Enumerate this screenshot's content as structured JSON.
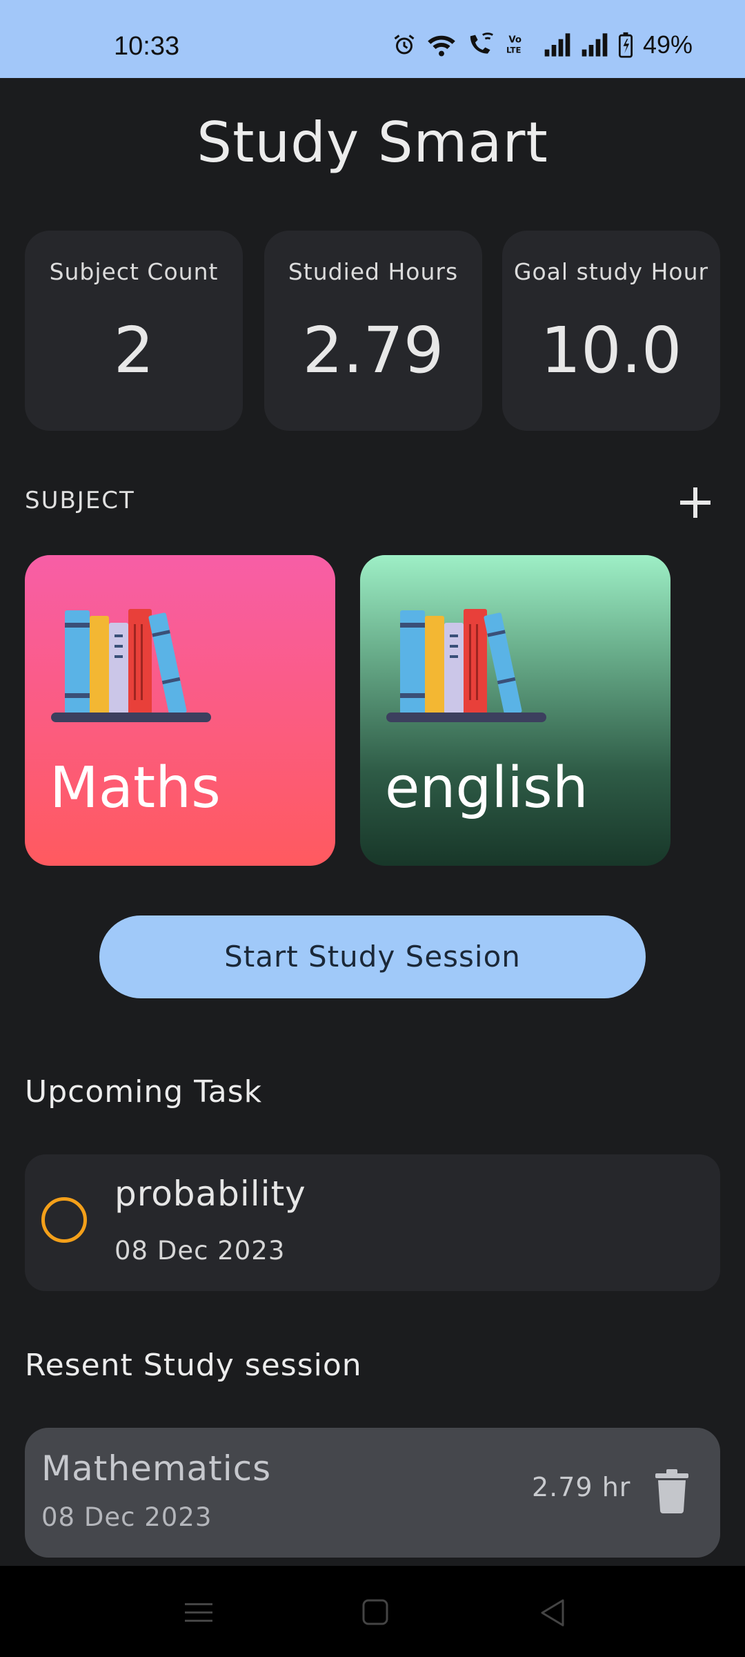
{
  "status_bar": {
    "time": "10:33",
    "battery": "49%",
    "icons": [
      "alarm-icon",
      "wifi-icon",
      "wifi-calling-icon",
      "volte-icon",
      "signal-icon",
      "signal-icon",
      "battery-charging-icon"
    ]
  },
  "app": {
    "title": "Study Smart"
  },
  "stats": [
    {
      "label": "Subject Count",
      "value": "2"
    },
    {
      "label": "Studied Hours",
      "value": "2.79"
    },
    {
      "label": "Goal study Hour",
      "value": "10.0"
    }
  ],
  "subjects_section": {
    "label": "SUBJECT",
    "add_icon": "plus-icon",
    "subjects": [
      {
        "name": "Maths",
        "gradient": [
          "#f75ea6",
          "#ff5a5f"
        ]
      },
      {
        "name": "english",
        "gradient": [
          "#9eefc6",
          "#183729"
        ]
      }
    ]
  },
  "start_button": {
    "label": "Start Study Session",
    "color": "#a0c9f9"
  },
  "upcoming": {
    "heading": "Upcoming Task",
    "tasks": [
      {
        "title": "probability",
        "date": "08 Dec 2023",
        "priority_color": "#f4a01a"
      }
    ]
  },
  "sessions": {
    "heading": "Resent Study session",
    "items": [
      {
        "subject": "Mathematics",
        "date": "08 Dec 2023",
        "duration": "2.79 hr"
      }
    ]
  },
  "nav": {
    "buttons": [
      "menu-icon",
      "home-icon",
      "back-icon"
    ]
  }
}
